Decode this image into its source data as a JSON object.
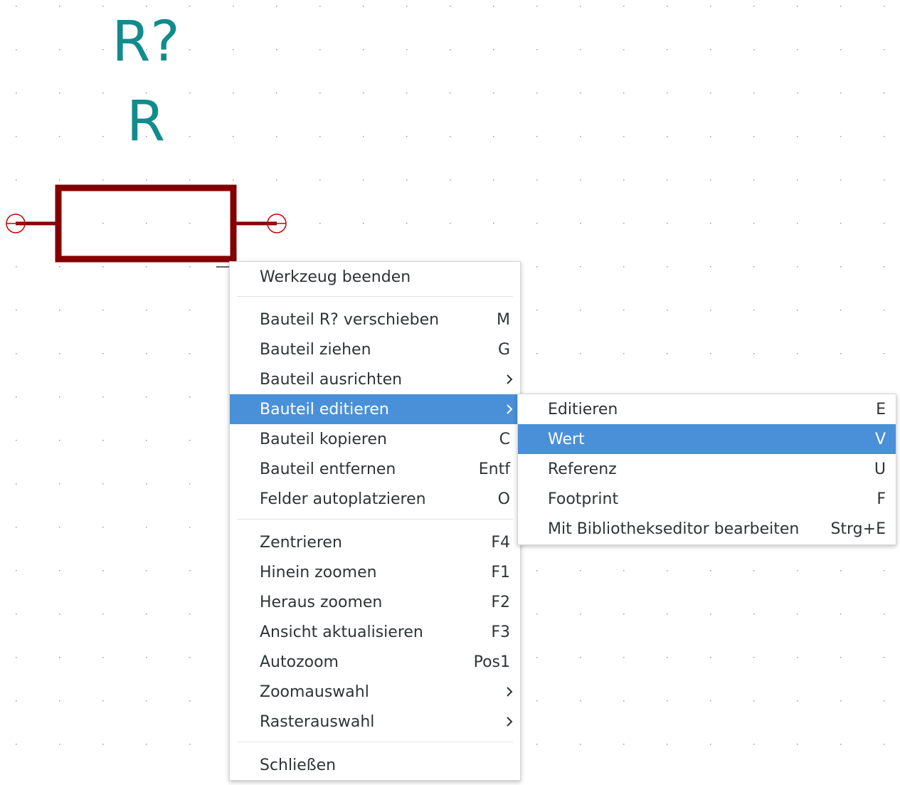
{
  "schematic": {
    "reference": "R?",
    "value": "R",
    "colors": {
      "text": "#118c8c",
      "body": "#840000",
      "grid": "#9a9a9a"
    }
  },
  "context_menu": {
    "items": [
      {
        "label": "Werkzeug beenden",
        "shortcut": ""
      },
      {
        "label": "Bauteil R? verschieben",
        "shortcut": "M"
      },
      {
        "label": "Bauteil ziehen",
        "shortcut": "G"
      },
      {
        "label": "Bauteil ausrichten",
        "shortcut": "",
        "submenu_icon": "chevron-right-icon"
      },
      {
        "label": "Bauteil editieren",
        "shortcut": "",
        "submenu_icon": "chevron-right-icon",
        "state": "highlighted"
      },
      {
        "label": "Bauteil kopieren",
        "shortcut": "C"
      },
      {
        "label": "Bauteil entfernen",
        "shortcut": "Entf"
      },
      {
        "label": "Felder autoplatzieren",
        "shortcut": "O"
      },
      {
        "label": "Zentrieren",
        "shortcut": "F4"
      },
      {
        "label": "Hinein zoomen",
        "shortcut": "F1"
      },
      {
        "label": "Heraus zoomen",
        "shortcut": "F2"
      },
      {
        "label": "Ansicht aktualisieren",
        "shortcut": "F3"
      },
      {
        "label": "Autozoom",
        "shortcut": "Pos1"
      },
      {
        "label": "Zoomauswahl",
        "shortcut": "",
        "submenu_icon": "chevron-right-icon"
      },
      {
        "label": "Rasterauswahl",
        "shortcut": "",
        "submenu_icon": "chevron-right-icon"
      },
      {
        "label": "Schließen",
        "shortcut": ""
      }
    ]
  },
  "submenu": {
    "items": [
      {
        "label": "Editieren",
        "shortcut": "E"
      },
      {
        "label": "Wert",
        "shortcut": "V",
        "state": "highlighted"
      },
      {
        "label": "Referenz",
        "shortcut": "U"
      },
      {
        "label": "Footprint",
        "shortcut": "F"
      },
      {
        "label": "Mit Bibliothekseditor bearbeiten",
        "shortcut": "Strg+E"
      }
    ]
  },
  "colors": {
    "highlight": "#4a90d9",
    "menu_text": "#2e3436"
  }
}
